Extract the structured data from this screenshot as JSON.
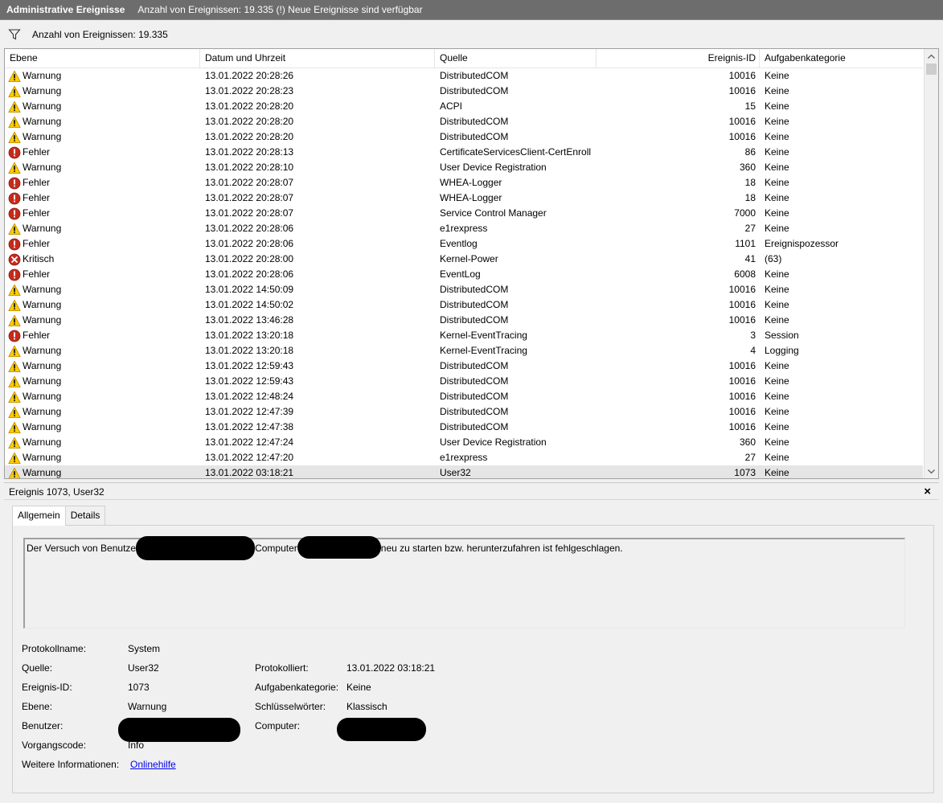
{
  "titlebar": {
    "title": "Administrative Ereignisse",
    "status": "Anzahl von Ereignissen: 19.335 (!) Neue Ereignisse sind verfügbar"
  },
  "filter": {
    "icon": "filter-icon",
    "label": "Anzahl von Ereignissen: 19.335"
  },
  "columns": {
    "level": "Ebene",
    "date": "Datum und Uhrzeit",
    "source": "Quelle",
    "id": "Ereignis-ID",
    "category": "Aufgabenkategorie"
  },
  "events": [
    {
      "level": "Warnung",
      "type": "warning",
      "date": "13.01.2022 20:28:26",
      "source": "DistributedCOM",
      "id": "10016",
      "category": "Keine"
    },
    {
      "level": "Warnung",
      "type": "warning",
      "date": "13.01.2022 20:28:23",
      "source": "DistributedCOM",
      "id": "10016",
      "category": "Keine"
    },
    {
      "level": "Warnung",
      "type": "warning",
      "date": "13.01.2022 20:28:20",
      "source": "ACPI",
      "id": "15",
      "category": "Keine"
    },
    {
      "level": "Warnung",
      "type": "warning",
      "date": "13.01.2022 20:28:20",
      "source": "DistributedCOM",
      "id": "10016",
      "category": "Keine"
    },
    {
      "level": "Warnung",
      "type": "warning",
      "date": "13.01.2022 20:28:20",
      "source": "DistributedCOM",
      "id": "10016",
      "category": "Keine"
    },
    {
      "level": "Fehler",
      "type": "error",
      "date": "13.01.2022 20:28:13",
      "source": "CertificateServicesClient-CertEnroll",
      "id": "86",
      "category": "Keine"
    },
    {
      "level": "Warnung",
      "type": "warning",
      "date": "13.01.2022 20:28:10",
      "source": "User Device Registration",
      "id": "360",
      "category": "Keine"
    },
    {
      "level": "Fehler",
      "type": "error",
      "date": "13.01.2022 20:28:07",
      "source": "WHEA-Logger",
      "id": "18",
      "category": "Keine"
    },
    {
      "level": "Fehler",
      "type": "error",
      "date": "13.01.2022 20:28:07",
      "source": "WHEA-Logger",
      "id": "18",
      "category": "Keine"
    },
    {
      "level": "Fehler",
      "type": "error",
      "date": "13.01.2022 20:28:07",
      "source": "Service Control Manager",
      "id": "7000",
      "category": "Keine"
    },
    {
      "level": "Warnung",
      "type": "warning",
      "date": "13.01.2022 20:28:06",
      "source": "e1rexpress",
      "id": "27",
      "category": "Keine"
    },
    {
      "level": "Fehler",
      "type": "error",
      "date": "13.01.2022 20:28:06",
      "source": "Eventlog",
      "id": "1101",
      "category": "Ereignispozessor"
    },
    {
      "level": "Kritisch",
      "type": "critical",
      "date": "13.01.2022 20:28:00",
      "source": "Kernel-Power",
      "id": "41",
      "category": "(63)"
    },
    {
      "level": "Fehler",
      "type": "error",
      "date": "13.01.2022 20:28:06",
      "source": "EventLog",
      "id": "6008",
      "category": "Keine"
    },
    {
      "level": "Warnung",
      "type": "warning",
      "date": "13.01.2022 14:50:09",
      "source": "DistributedCOM",
      "id": "10016",
      "category": "Keine"
    },
    {
      "level": "Warnung",
      "type": "warning",
      "date": "13.01.2022 14:50:02",
      "source": "DistributedCOM",
      "id": "10016",
      "category": "Keine"
    },
    {
      "level": "Warnung",
      "type": "warning",
      "date": "13.01.2022 13:46:28",
      "source": "DistributedCOM",
      "id": "10016",
      "category": "Keine"
    },
    {
      "level": "Fehler",
      "type": "error",
      "date": "13.01.2022 13:20:18",
      "source": "Kernel-EventTracing",
      "id": "3",
      "category": "Session"
    },
    {
      "level": "Warnung",
      "type": "warning",
      "date": "13.01.2022 13:20:18",
      "source": "Kernel-EventTracing",
      "id": "4",
      "category": "Logging"
    },
    {
      "level": "Warnung",
      "type": "warning",
      "date": "13.01.2022 12:59:43",
      "source": "DistributedCOM",
      "id": "10016",
      "category": "Keine"
    },
    {
      "level": "Warnung",
      "type": "warning",
      "date": "13.01.2022 12:59:43",
      "source": "DistributedCOM",
      "id": "10016",
      "category": "Keine"
    },
    {
      "level": "Warnung",
      "type": "warning",
      "date": "13.01.2022 12:48:24",
      "source": "DistributedCOM",
      "id": "10016",
      "category": "Keine"
    },
    {
      "level": "Warnung",
      "type": "warning",
      "date": "13.01.2022 12:47:39",
      "source": "DistributedCOM",
      "id": "10016",
      "category": "Keine"
    },
    {
      "level": "Warnung",
      "type": "warning",
      "date": "13.01.2022 12:47:38",
      "source": "DistributedCOM",
      "id": "10016",
      "category": "Keine"
    },
    {
      "level": "Warnung",
      "type": "warning",
      "date": "13.01.2022 12:47:24",
      "source": "User Device Registration",
      "id": "360",
      "category": "Keine"
    },
    {
      "level": "Warnung",
      "type": "warning",
      "date": "13.01.2022 12:47:20",
      "source": "e1rexpress",
      "id": "27",
      "category": "Keine"
    },
    {
      "level": "Warnung",
      "type": "warning",
      "date": "13.01.2022 03:18:21",
      "source": "User32",
      "id": "1073",
      "category": "Keine",
      "selected": true
    }
  ],
  "detail": {
    "header": "Ereignis 1073, User32",
    "close": "×",
    "tabs": [
      "Allgemein",
      "Details"
    ],
    "message_part1": "Der Versuch von Benutze",
    "message_part2": "Computer",
    "message_part3": "neu zu starten bzw. herunterzufahren ist fehlgeschlagen.",
    "fields": {
      "protokollname_label": "Protokollname:",
      "protokollname": "System",
      "quelle_label": "Quelle:",
      "quelle": "User32",
      "protokolliert_label": "Protokolliert:",
      "protokolliert": "13.01.2022 03:18:21",
      "id_label": "Ereignis-ID:",
      "id": "1073",
      "kategorie_label": "Aufgabenkategorie:",
      "kategorie": "Keine",
      "ebene_label": "Ebene:",
      "ebene": "Warnung",
      "schluessel_label": "Schlüsselwörter:",
      "schluessel": "Klassisch",
      "benutzer_label": "Benutzer:",
      "computer_label": "Computer:",
      "vorgang_label": "Vorgangscode:",
      "vorgang": "Info",
      "weitere_label": "Weitere Informationen:",
      "weitere_link": "Onlinehilfe"
    }
  },
  "colors": {
    "titlebar_bg": "#6d6d6d",
    "warning": "#ffcc00",
    "error": "#c42b1c",
    "critical": "#c42b1c",
    "link": "#0000ee",
    "selected_row": "#e5e5e5"
  }
}
